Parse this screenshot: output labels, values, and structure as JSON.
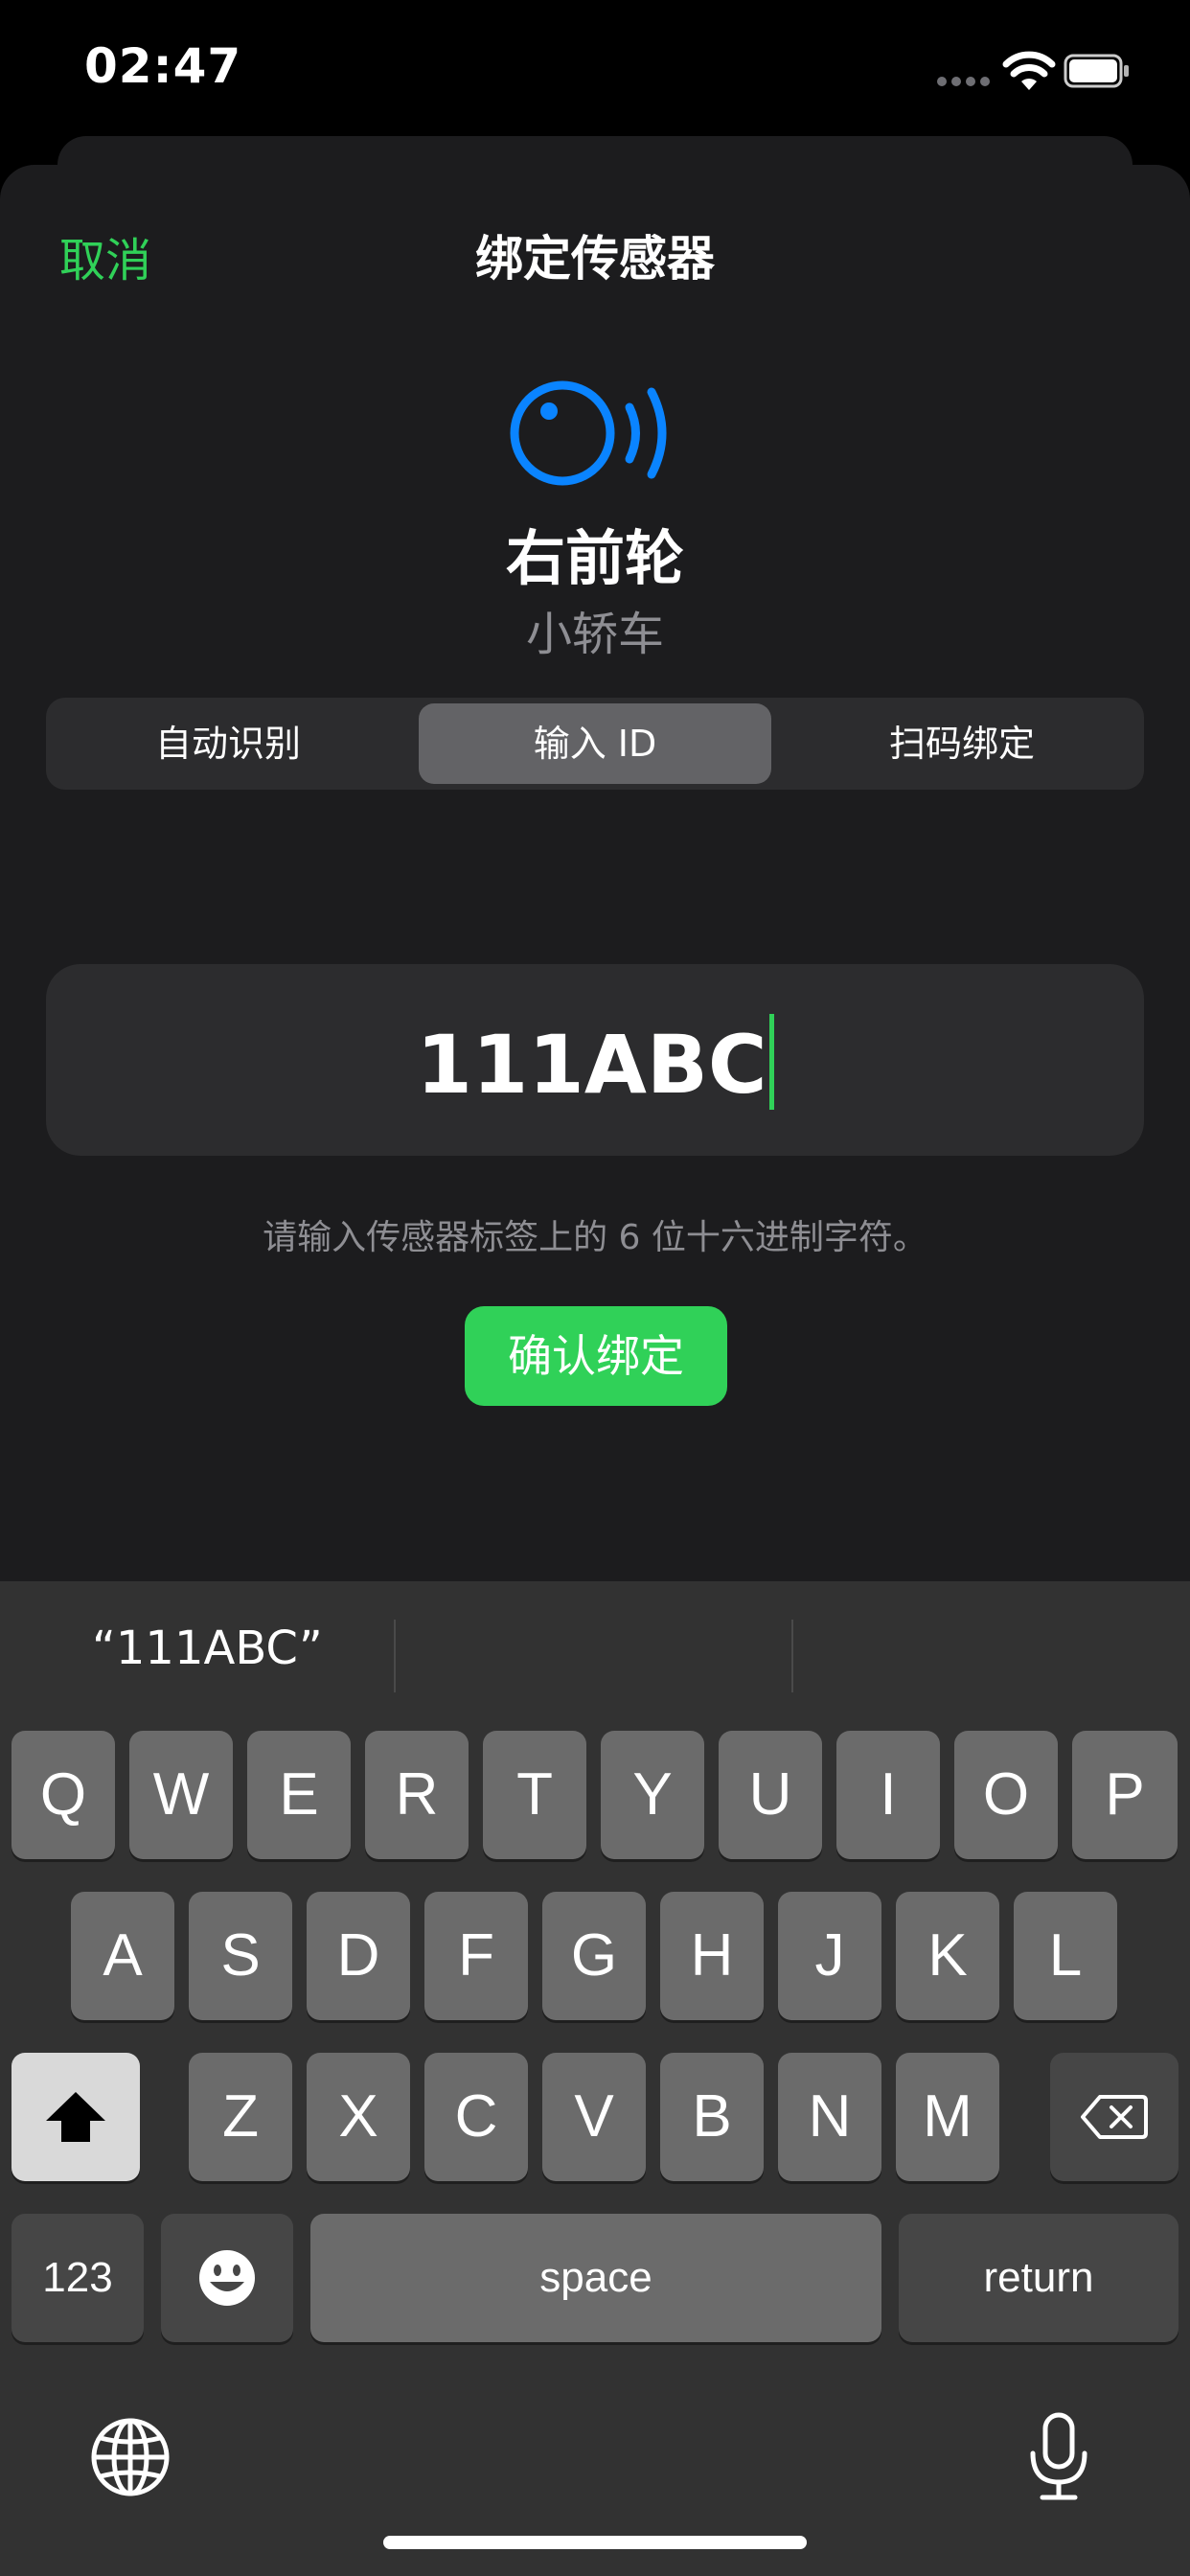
{
  "status_bar": {
    "time": "02:47"
  },
  "header": {
    "cancel_label": "取消",
    "title": "绑定传感器"
  },
  "sensor": {
    "icon": "tire-sensor-icon",
    "position": "右前轮",
    "vehicle_type": "小轿车"
  },
  "tabs": [
    {
      "label": "自动识别",
      "selected": false
    },
    {
      "label": "输入 ID",
      "selected": true
    },
    {
      "label": "扫码绑定",
      "selected": false
    }
  ],
  "id_input": {
    "value": "111ABC"
  },
  "hint": "请输入传感器标签上的 6 位十六进制字符。",
  "confirm_label": "确认绑定",
  "keyboard": {
    "suggestion": "“111ABC”",
    "row1": [
      "Q",
      "W",
      "E",
      "R",
      "T",
      "Y",
      "U",
      "I",
      "O",
      "P"
    ],
    "row2": [
      "A",
      "S",
      "D",
      "F",
      "G",
      "H",
      "J",
      "K",
      "L"
    ],
    "row3": [
      "Z",
      "X",
      "C",
      "V",
      "B",
      "N",
      "M"
    ],
    "numbers_label": "123",
    "space_label": "space",
    "return_label": "return"
  },
  "colors": {
    "accent_green": "#30d158",
    "sensor_blue": "#0a84ff",
    "sheet_bg": "#1c1c1e"
  }
}
